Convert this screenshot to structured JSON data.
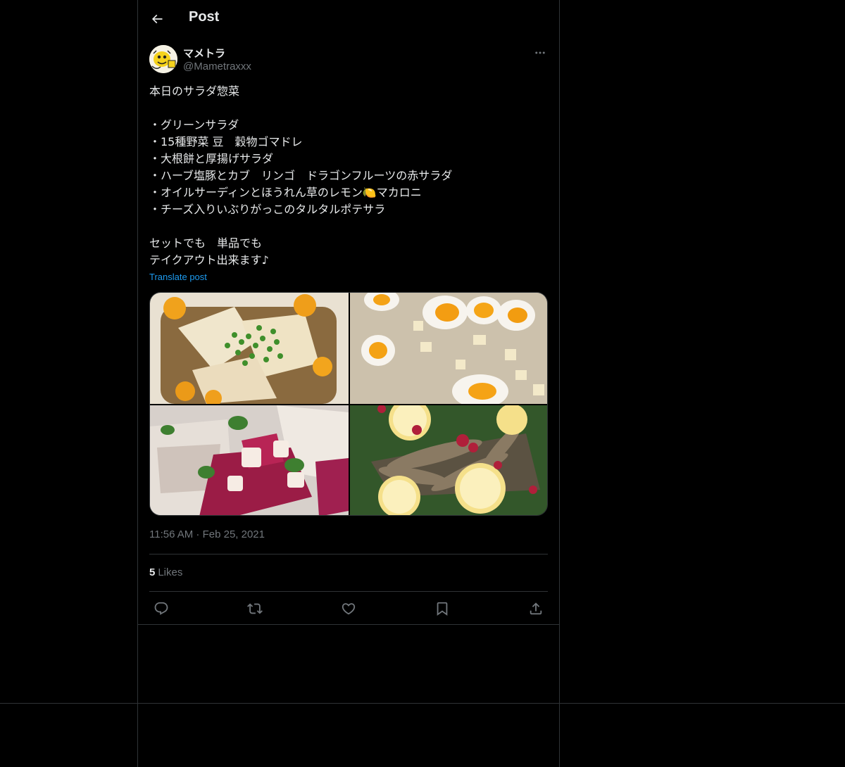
{
  "header": {
    "title": "Post"
  },
  "author": {
    "display_name": "マメトラ",
    "handle": "@Mametraxxx"
  },
  "post": {
    "text": "本日のサラダ惣菜\n\n・グリーンサラダ\n・15種野菜 豆　穀物ゴマドレ\n・大根餅と厚揚げサラダ\n・ハーブ塩豚とカブ　リンゴ　ドラゴンフルーツの赤サラダ\n・オイルサーディンとほうれん草のレモン🍋マカロニ\n・チーズ入りいぶりがっこのタルタルポテサラ\n\nセットでも　単品でも\nテイクアウト出来ます♪",
    "translate_label": "Translate post",
    "timestamp": "11:56 AM · Feb 25, 2021",
    "likes_count": "5",
    "likes_label": "Likes"
  },
  "icons": {
    "back": "arrow-left-icon",
    "more": "more-horizontal-icon",
    "reply": "reply-icon",
    "repost": "repost-icon",
    "like": "heart-icon",
    "bookmark": "bookmark-icon",
    "share": "share-icon"
  },
  "colors": {
    "background": "#000000",
    "text": "#e7e9ea",
    "muted": "#71767b",
    "link": "#1d9bf0",
    "border": "#2f3336"
  }
}
